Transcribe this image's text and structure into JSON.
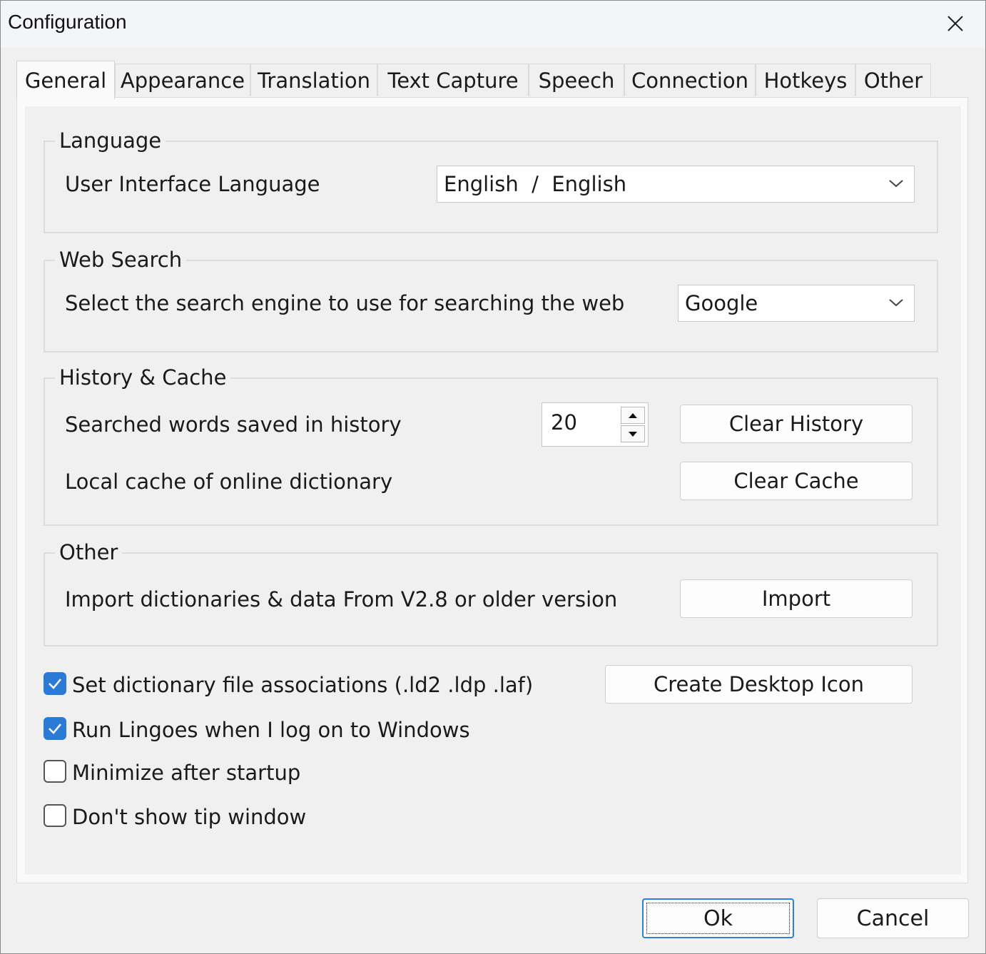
{
  "window": {
    "title": "Configuration"
  },
  "tabs": [
    {
      "label": "General",
      "active": true
    },
    {
      "label": "Appearance"
    },
    {
      "label": "Translation"
    },
    {
      "label": "Text Capture"
    },
    {
      "label": "Speech"
    },
    {
      "label": "Connection"
    },
    {
      "label": "Hotkeys"
    },
    {
      "label": "Other"
    }
  ],
  "language": {
    "group_label": "Language",
    "ui_language_label": "User Interface Language",
    "ui_language_value": "English  /  English"
  },
  "web_search": {
    "group_label": "Web Search",
    "engine_label": "Select the search engine to use for searching the web",
    "engine_value": "Google"
  },
  "history_cache": {
    "group_label": "History & Cache",
    "history_label": "Searched words saved in history",
    "history_count": "20",
    "clear_history_label": "Clear History",
    "cache_label": "Local cache of online dictionary",
    "clear_cache_label": "Clear Cache"
  },
  "other": {
    "group_label": "Other",
    "import_label": "Import dictionaries & data From V2.8 or older version",
    "import_button": "Import"
  },
  "options": {
    "file_assoc": {
      "label": "Set dictionary file associations (.ld2 .ldp .laf)",
      "checked": true
    },
    "run_on_logon": {
      "label": "Run Lingoes when I log on to Windows",
      "checked": true
    },
    "minimize_startup": {
      "label": "Minimize after startup",
      "checked": false
    },
    "no_tip_window": {
      "label": "Don't show tip window",
      "checked": false
    },
    "create_desktop_icon": "Create Desktop Icon"
  },
  "footer": {
    "ok_label": "Ok",
    "cancel_label": "Cancel"
  },
  "colors": {
    "accent": "#2a7ad6",
    "background": "#f0f0f0"
  }
}
